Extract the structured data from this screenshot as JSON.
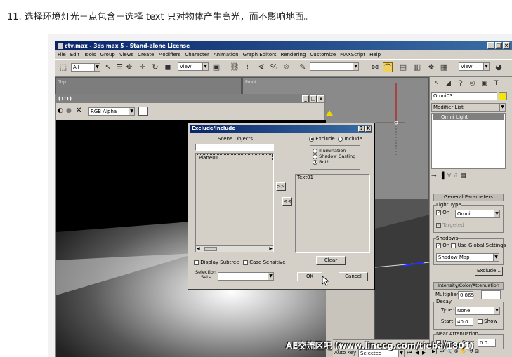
{
  "caption": "11. 选择环境灯光－点包含－选择 text 只对物体产生高光，而不影响地面。",
  "app": {
    "title": "ctv.max - 3ds max 5 - Stand-alone License",
    "title_icon": "max-icon",
    "menu": [
      "File",
      "Edit",
      "Tools",
      "Group",
      "Views",
      "Create",
      "Modifiers",
      "Character",
      "Animation",
      "Graph Editors",
      "Rendering",
      "Customize",
      "MAXScript",
      "Help"
    ],
    "toolbar": {
      "selection_filter": "All",
      "ref_coord": "View",
      "named_sel": "",
      "view_combo": "View"
    },
    "viewports": {
      "top_label": "Top",
      "front_label": "Front"
    }
  },
  "render_window": {
    "title": "(1:1)",
    "channel": "RGB Alpha"
  },
  "dialog": {
    "title": "Exclude/Include",
    "help_btn": "?",
    "close_btn": "X",
    "scene_objects_label": "Scene Objects",
    "scene_list": [
      "Plane01"
    ],
    "mode": {
      "exclude": "Exclude",
      "include": "Include",
      "selected": "include"
    },
    "illum_options": {
      "illumination": "Illumination",
      "shadow_casting": "Shadow Casting",
      "both": "Both",
      "selected": "both"
    },
    "add_btn": ">>",
    "remove_btn": "<<",
    "include_list": [
      "Text01"
    ],
    "display_subtree": "Display Subtree",
    "case_sensitive": "Case Sensitive",
    "clear_btn": "Clear",
    "selection_sets_label": "Selection\nSets",
    "ok_btn": "OK",
    "cancel_btn": "Cancel"
  },
  "cmd_panel": {
    "object_name": "Omni03",
    "modifier_list": "Modifier List",
    "stack_item": "Omni Light",
    "general_params": "General Parameters",
    "light_type_label": "Light Type",
    "on_label": "On",
    "light_type": "Omni",
    "targeted": "Targeted",
    "shadows_label": "Shadows",
    "use_global": "Use Global Settings",
    "shadow_type": "Shadow Map",
    "exclude_btn": "Exclude...",
    "intensity_rollout": "Intensity/Color/Attenuation",
    "multiplier_label": "Multiplier:",
    "multiplier": "0.865",
    "decay_label": "Decay",
    "type_label": "Type:",
    "decay_type": "None",
    "start_label": "Start:",
    "decay_start": "40.0",
    "show_label": "Show",
    "near_atten_label": "Near Attenuation",
    "use_label": "Use",
    "near_start": "0.0"
  },
  "status": {
    "autokey": "Auto Key",
    "selected": "Selected",
    "counter": "80"
  },
  "watermark": "AE交流区吧 (www.linecg.com/tieba/1801)",
  "colors": {
    "title_blue": "#0a246a",
    "light_swatch": "#f5e60a"
  }
}
